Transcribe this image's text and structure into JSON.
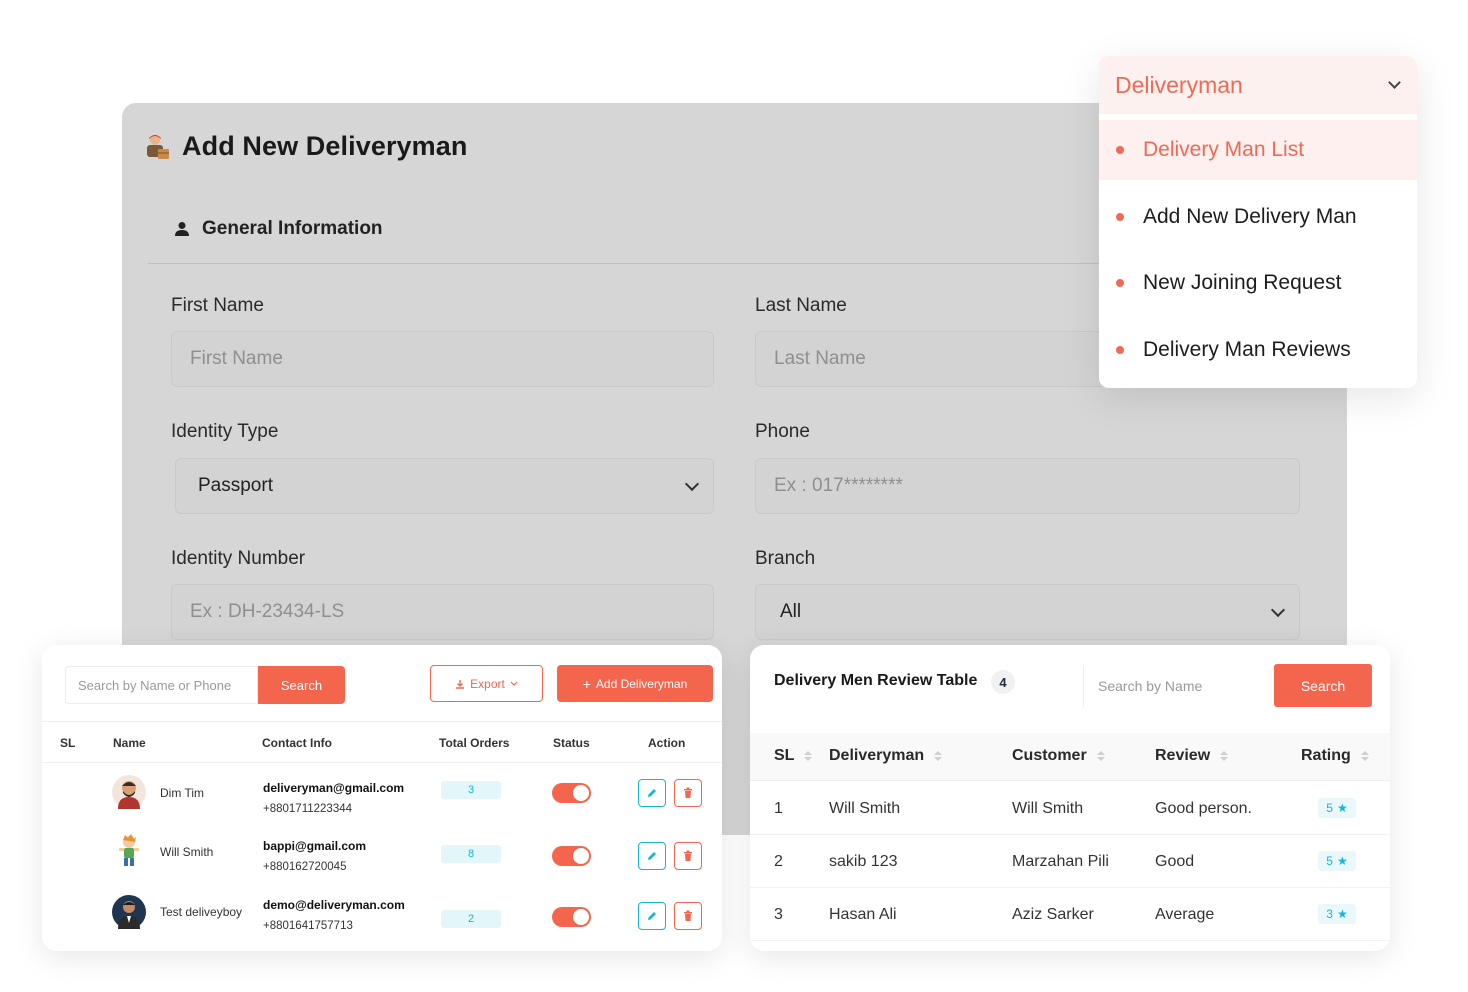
{
  "form": {
    "title": "Add New Deliveryman",
    "section": "General Information",
    "fields": {
      "first_name_label": "First Name",
      "first_name_placeholder": "First Name",
      "last_name_label": "Last Name",
      "last_name_placeholder": "Last Name",
      "identity_type_label": "Identity Type",
      "identity_type_value": "Passport",
      "phone_label": "Phone",
      "phone_placeholder": "Ex : 017********",
      "identity_number_label": "Identity Number",
      "identity_number_placeholder": "Ex : DH-23434-LS",
      "branch_label": "Branch",
      "branch_value": "All"
    }
  },
  "menu": {
    "title": "Deliveryman",
    "items": [
      {
        "label": "Delivery Man List",
        "active": true
      },
      {
        "label": "Add New Delivery Man",
        "active": false
      },
      {
        "label": "New Joining Request",
        "active": false
      },
      {
        "label": "Delivery Man Reviews",
        "active": false
      }
    ]
  },
  "list": {
    "search_placeholder": "Search by Name or Phone",
    "search_label": "Search",
    "export_label": "Export",
    "add_label": "Add Deliveryman",
    "columns": [
      "SL",
      "Name",
      "Contact Info",
      "Total Orders",
      "Status",
      "Action"
    ],
    "rows": [
      {
        "name": "Dim Tim",
        "email": "deliveryman@gmail.com",
        "phone": "+8801711223344",
        "orders": "3"
      },
      {
        "name": "Will Smith",
        "email": "bappi@gmail.com",
        "phone": "+880162720045",
        "orders": "8"
      },
      {
        "name": "Test deliveyboy",
        "email": "demo@deliveryman.com",
        "phone": "+8801641757713",
        "orders": "2"
      }
    ]
  },
  "reviews": {
    "title": "Delivery Men Review Table",
    "count": "4",
    "search_placeholder": "Search by Name",
    "search_label": "Search",
    "columns": [
      "SL",
      "Deliveryman",
      "Customer",
      "Review",
      "Rating"
    ],
    "rows": [
      {
        "sl": "1",
        "deliveryman": "Will Smith",
        "customer": "Will Smith",
        "review": "Good person.",
        "rating": "5"
      },
      {
        "sl": "2",
        "deliveryman": "sakib 123",
        "customer": "Marzahan Pili",
        "review": "Good",
        "rating": "5"
      },
      {
        "sl": "3",
        "deliveryman": "Hasan Ali",
        "customer": "Aziz Sarker",
        "review": "Average",
        "rating": "3"
      }
    ]
  },
  "colors": {
    "accent": "#f4654d",
    "info": "#16b6d4"
  }
}
